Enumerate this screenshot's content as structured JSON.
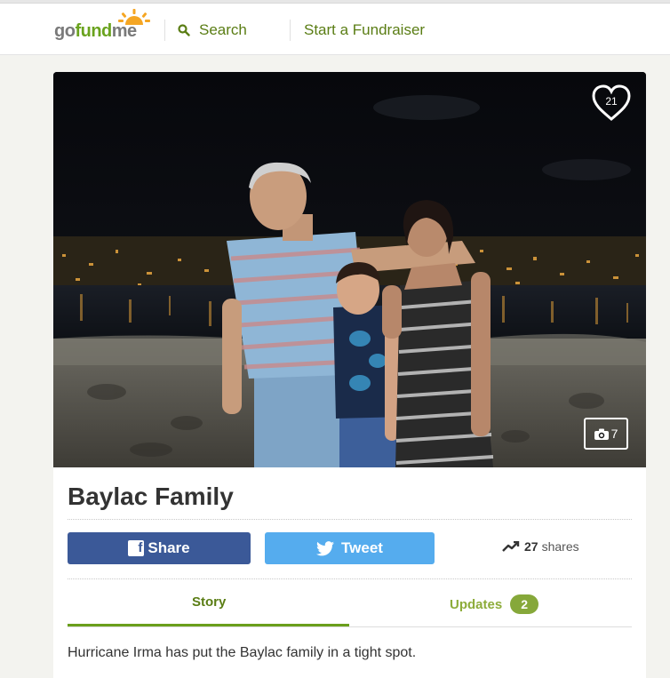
{
  "header": {
    "logo": {
      "go": "go",
      "fund": "fund",
      "me": "me"
    },
    "search_label": "Search",
    "start_label": "Start a Fundraiser"
  },
  "campaign": {
    "like_count": "21",
    "photo_count": "7",
    "title": "Baylac Family",
    "share_label": "Share",
    "tweet_label": "Tweet",
    "shares_count": "27",
    "shares_label": "shares",
    "tabs": {
      "story": "Story",
      "updates": "Updates",
      "updates_count": "2"
    },
    "story_text": "Hurricane Irma has put the Baylac family in a tight spot."
  },
  "icons": {
    "search": "search-icon",
    "heart": "heart-icon",
    "camera": "camera-icon",
    "facebook": "facebook-icon",
    "twitter": "twitter-icon",
    "trend": "trending-up-icon"
  },
  "colors": {
    "brand_green": "#6aa31e",
    "nav_green": "#5a7d14",
    "facebook_blue": "#3b5998",
    "twitter_blue": "#55acee",
    "badge_green": "#86a83a"
  }
}
